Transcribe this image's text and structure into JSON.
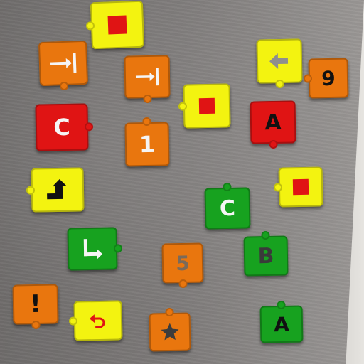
{
  "tiles": {
    "one": "1",
    "nine": "9",
    "five": "5",
    "c_red": "C",
    "c_green": "C",
    "a_red": "A",
    "a_green": "A",
    "b_green": "B",
    "exclaim": "!"
  },
  "colors": {
    "orange": "#e9760e",
    "yellow": "#f3f310",
    "red": "#e01414",
    "green": "#17a21f"
  },
  "icons": [
    "move-to-end-icon",
    "stop-square-icon",
    "arrow-left-icon",
    "turn-up-right-icon",
    "corner-arrow-icon",
    "undo-arrow-icon",
    "star-icon"
  ]
}
